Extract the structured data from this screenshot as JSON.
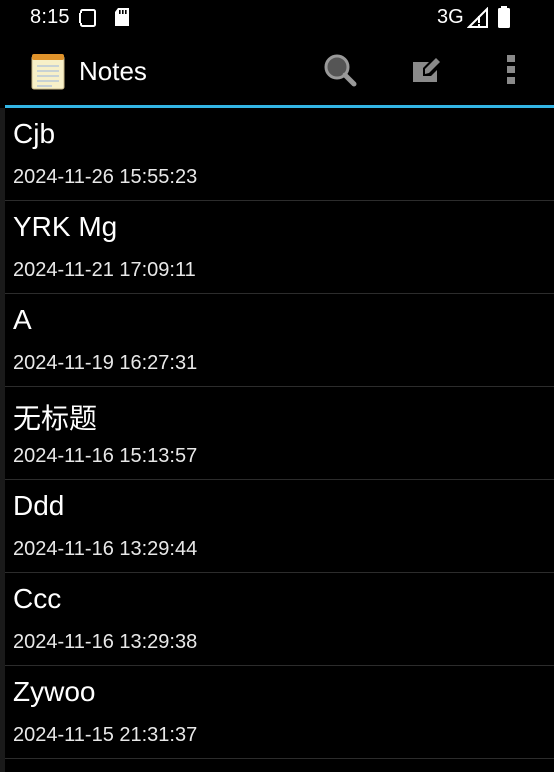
{
  "status_bar": {
    "time": "8:15",
    "network": "3G",
    "icons": [
      "screenshot-icon",
      "sd-card-icon",
      "signal-icon",
      "battery-icon"
    ]
  },
  "action_bar": {
    "title": "Notes",
    "accent_color": "#33b5e5",
    "icons": [
      "notes-app-icon",
      "search-icon",
      "new-note-icon",
      "overflow-menu-icon"
    ]
  },
  "notes": [
    {
      "title": "Cjb",
      "date": "2024-11-26 15:55:23"
    },
    {
      "title": "YRK Mg",
      "date": "2024-11-21 17:09:11"
    },
    {
      "title": "A",
      "date": "2024-11-19 16:27:31"
    },
    {
      "title": "无标题",
      "date": "2024-11-16 15:13:57"
    },
    {
      "title": "Ddd",
      "date": "2024-11-16 13:29:44"
    },
    {
      "title": "Ccc",
      "date": "2024-11-16 13:29:38"
    },
    {
      "title": "Zywoo",
      "date": "2024-11-15 21:31:37"
    }
  ]
}
